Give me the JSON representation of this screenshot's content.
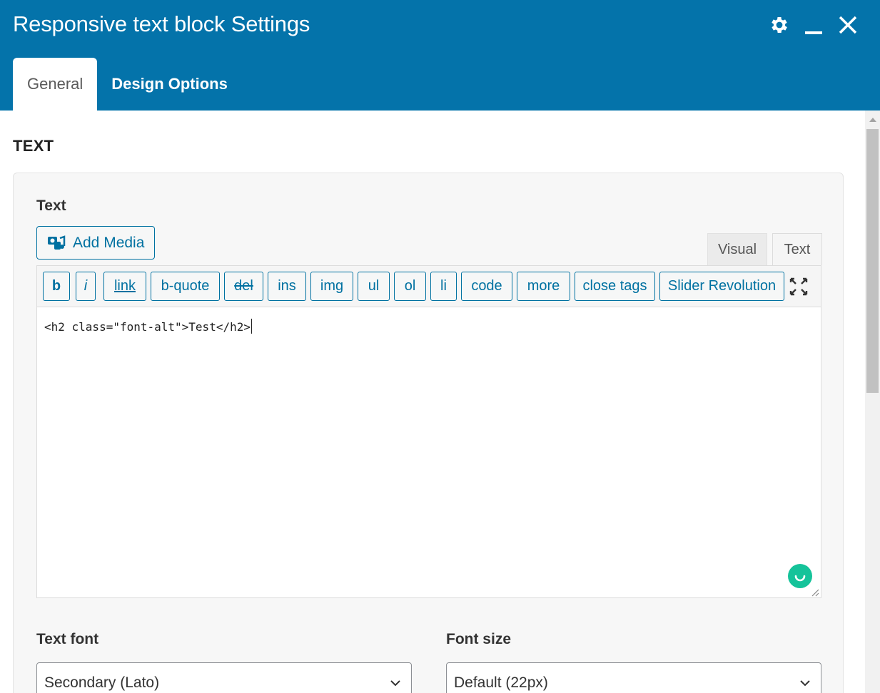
{
  "header": {
    "title": "Responsive text block Settings",
    "bg_color": "#0473aa",
    "icons": [
      "gear-icon",
      "minimize-icon",
      "close-icon"
    ],
    "tabs": [
      {
        "label": "General",
        "active": true
      },
      {
        "label": "Design Options",
        "active": false
      }
    ]
  },
  "section": {
    "title": "TEXT"
  },
  "text_field": {
    "label": "Text",
    "add_media_label": "Add Media",
    "mode_tabs": [
      {
        "label": "Visual",
        "active": false
      },
      {
        "label": "Text",
        "active": true
      }
    ],
    "quicktags": [
      {
        "label": "b",
        "style": "bold"
      },
      {
        "label": "i",
        "style": "italic"
      },
      {
        "label": "link",
        "style": "underline"
      },
      {
        "label": "b-quote",
        "style": "normal"
      },
      {
        "label": "del",
        "style": "strike"
      },
      {
        "label": "ins",
        "style": "normal"
      },
      {
        "label": "img",
        "style": "normal"
      },
      {
        "label": "ul",
        "style": "normal"
      },
      {
        "label": "ol",
        "style": "normal"
      },
      {
        "label": "li",
        "style": "normal"
      },
      {
        "label": "code",
        "style": "normal"
      },
      {
        "label": "more",
        "style": "normal"
      },
      {
        "label": "close tags",
        "style": "normal"
      },
      {
        "label": "Slider Revolution",
        "style": "normal"
      }
    ],
    "content": "<h2 class=\"font-alt\">Test</h2>",
    "accent_color": "#0071a1"
  },
  "text_font": {
    "label": "Text font",
    "value": "Secondary (Lato)"
  },
  "font_size": {
    "label": "Font size",
    "value": "Default (22px)"
  }
}
